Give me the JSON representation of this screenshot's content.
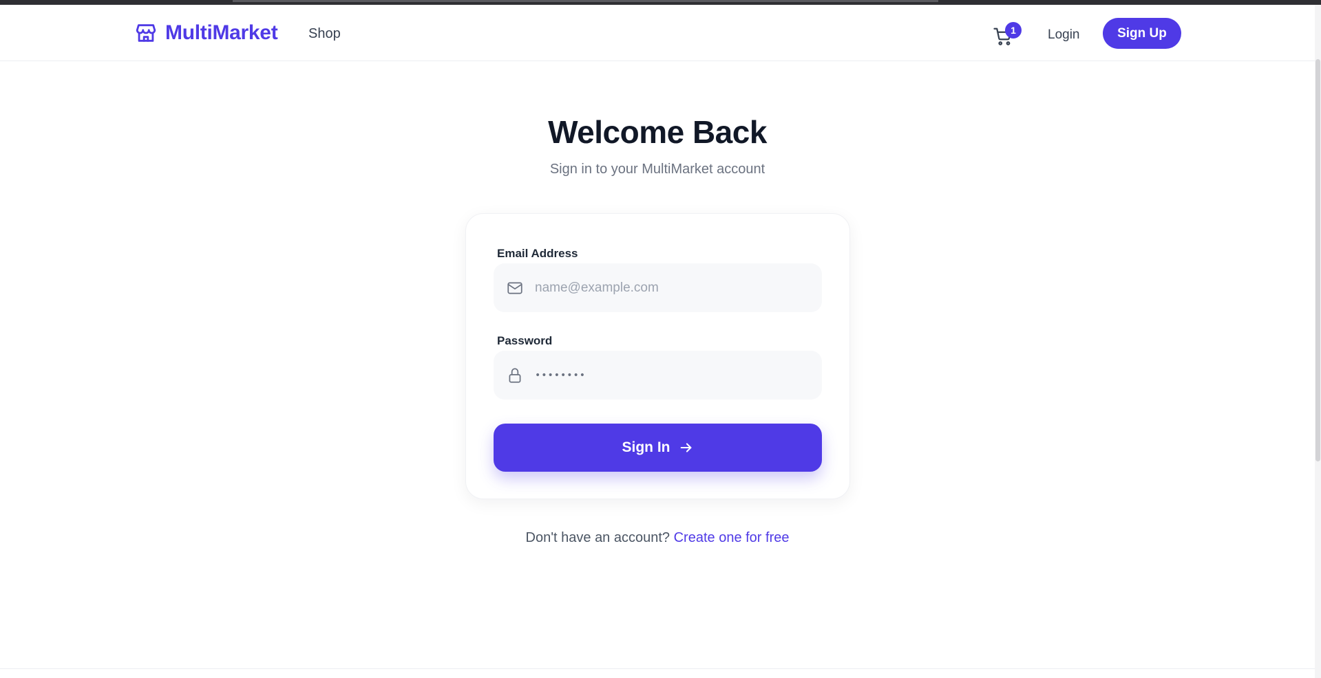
{
  "header": {
    "brand_name": "MultiMarket",
    "brand_icon": "store-icon",
    "nav_shop": "Shop",
    "cart_icon": "cart-icon",
    "cart_count": "1",
    "login_label": "Login",
    "signup_label": "Sign Up"
  },
  "page": {
    "title": "Welcome Back",
    "subtitle": "Sign in to your MultiMarket account"
  },
  "form": {
    "email_label": "Email Address",
    "email_placeholder": "name@example.com",
    "email_value": "",
    "email_icon": "mail-icon",
    "password_label": "Password",
    "password_value": "••••••••",
    "password_icon": "lock-icon",
    "submit_label": "Sign In",
    "submit_icon": "arrow-right-icon"
  },
  "footer": {
    "question": "Don't have an account?",
    "link": "Create one for free"
  },
  "colors": {
    "accent": "#4f3ae6",
    "text_dark": "#111827",
    "text_muted": "#6b7280",
    "field_bg": "#f7f8fa"
  }
}
